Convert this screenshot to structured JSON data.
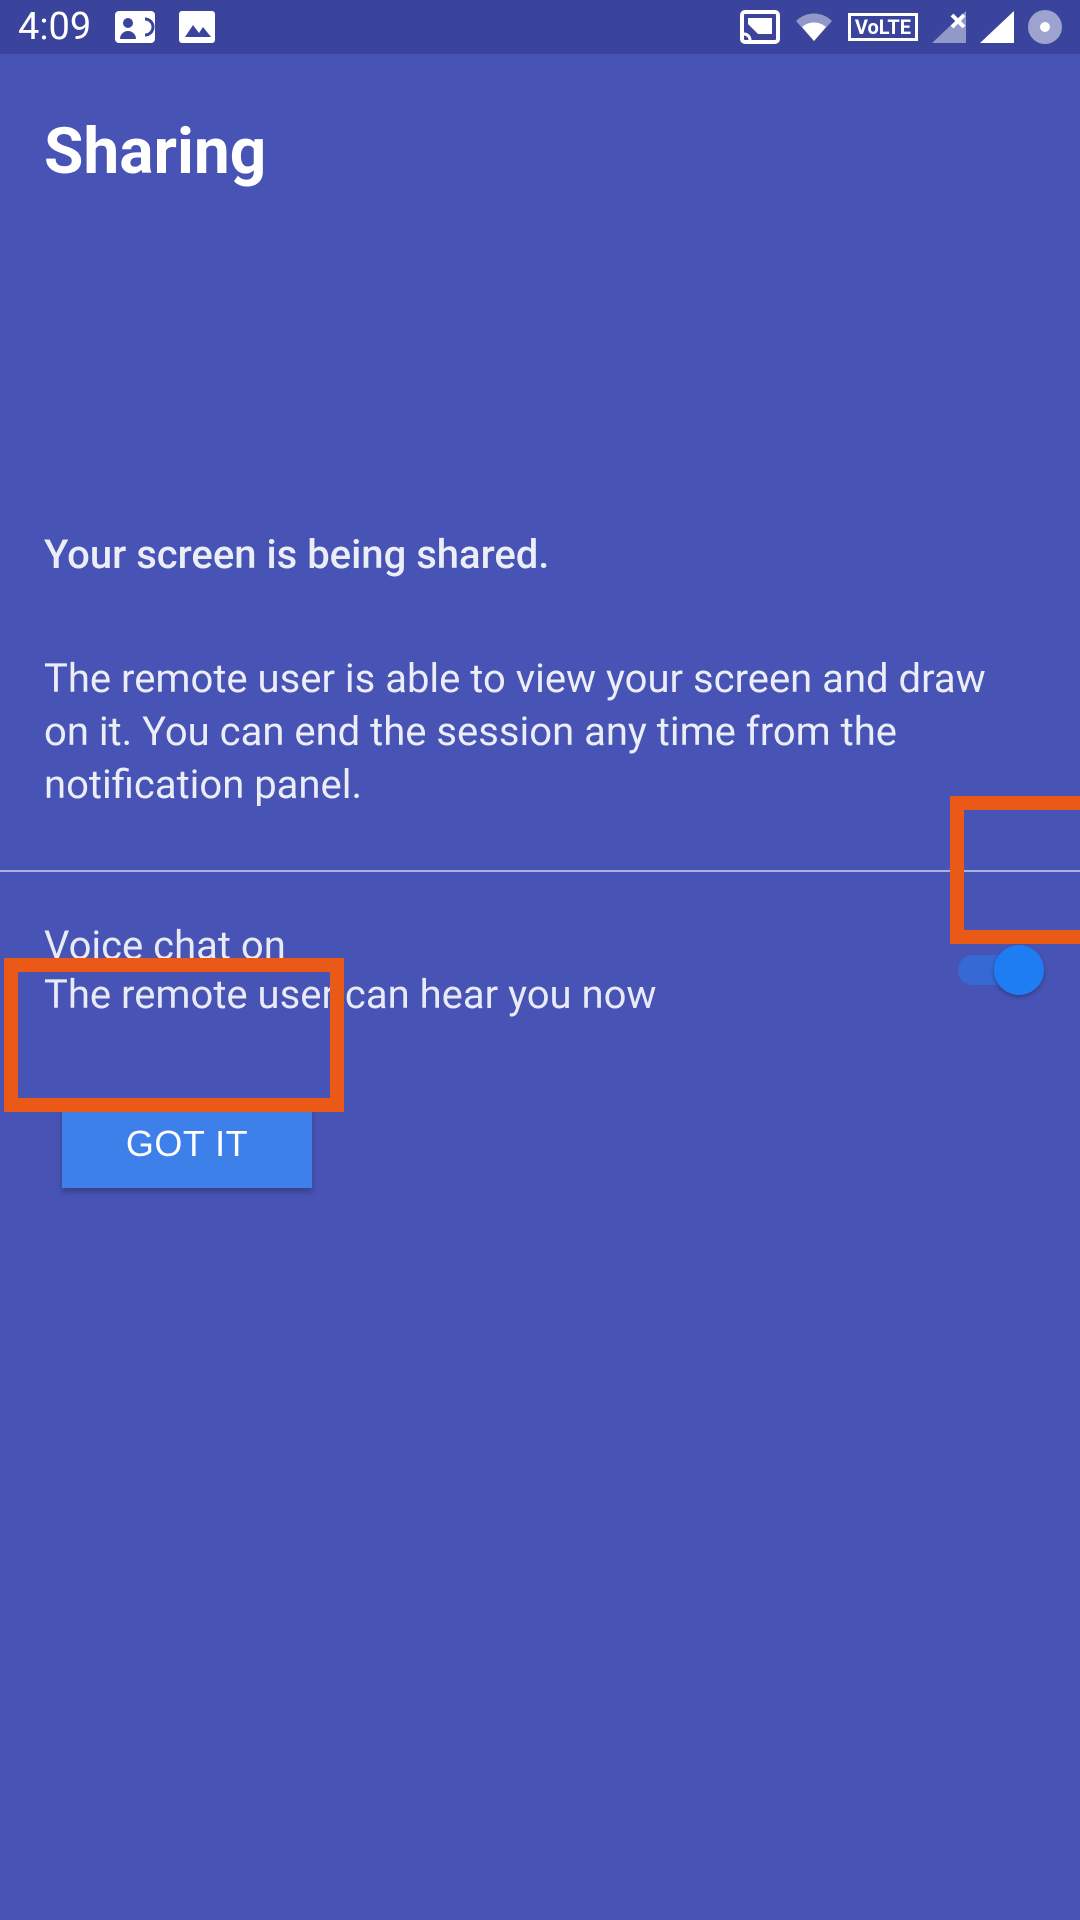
{
  "status": {
    "time": "4:09",
    "left_icons": [
      "card-contact-icon",
      "image-icon"
    ],
    "right_icons": [
      "cast-icon",
      "wifi-icon",
      "volte-badge",
      "signal-x-icon",
      "signal-bar-icon",
      "dot-icon"
    ],
    "volte_label": "VoLTE"
  },
  "header": {
    "title": "Sharing"
  },
  "main": {
    "sharing_line": "Your screen is being shared.",
    "sharing_desc": "The remote user is able to view your screen and draw on it. You can end the session any time from the notification panel."
  },
  "voice": {
    "title": "Voice chat on",
    "subtitle": "The remote user can hear you now",
    "enabled": true
  },
  "actions": {
    "gotit_label": "GOT IT"
  },
  "annotations": {
    "highlight_toggle": true,
    "highlight_button": true,
    "highlight_color": "#ea5a16"
  },
  "colors": {
    "background": "#4854b5",
    "statusbar": "#3a449c",
    "button": "#3e80e9",
    "toggle_knob": "#1f7df3"
  }
}
